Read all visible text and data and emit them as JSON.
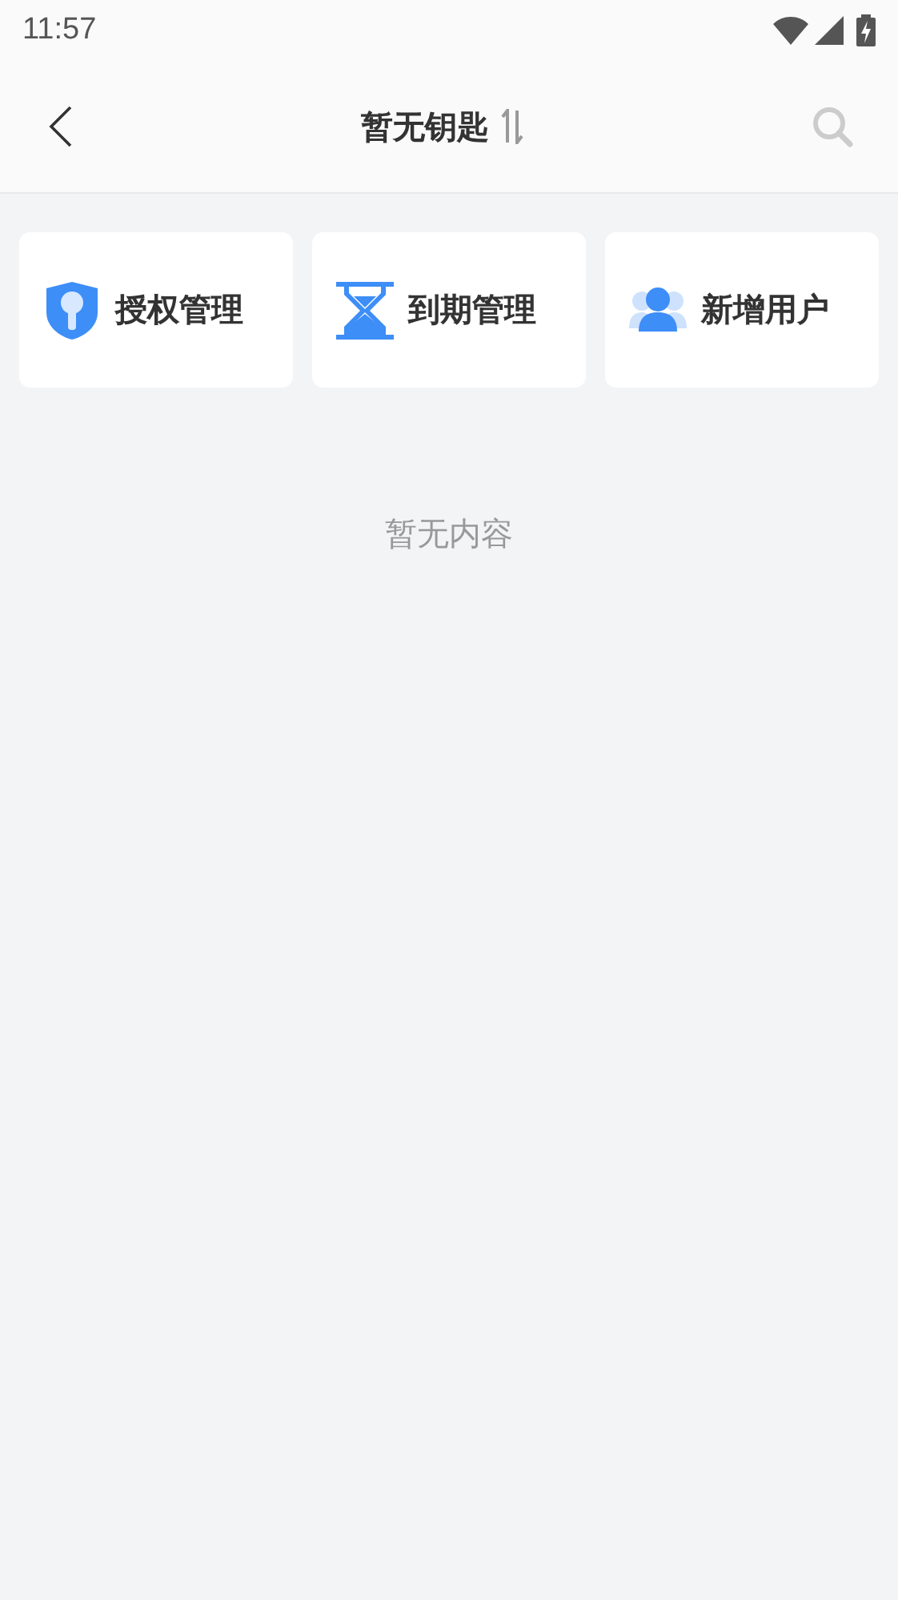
{
  "status_bar": {
    "time": "11:57"
  },
  "header": {
    "title": "暂无钥匙"
  },
  "actions": [
    {
      "kind": "shield",
      "label": "授权管理"
    },
    {
      "kind": "hourglass",
      "label": "到期管理"
    },
    {
      "kind": "users",
      "label": "新增用户"
    }
  ],
  "empty_message": "暂无内容"
}
